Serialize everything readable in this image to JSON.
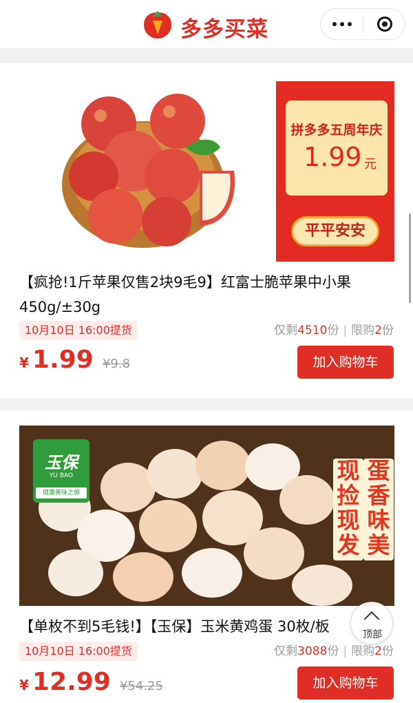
{
  "header": {
    "title": "多多买菜",
    "more_icon": "more-dots-icon",
    "close_icon": "close-target-icon"
  },
  "products": [
    {
      "promo": {
        "title": "拼多多五周年庆",
        "price": "1.99",
        "unit": "元",
        "badge": "平平安安"
      },
      "title": "【疯抢!1斤苹果仅售2块9毛9】红富士脆苹果中小果 450g/±30g",
      "pickup": "10月10日 16:00提货",
      "stock_prefix": "仅剩",
      "stock_count": "4510",
      "stock_suffix": "份",
      "limit_prefix": "限购",
      "limit_count": "2",
      "limit_suffix": "份",
      "currency": "¥",
      "price": "1.99",
      "original_price": "¥9.8",
      "cart_label": "加入购物车"
    },
    {
      "brand": {
        "name": "玉保",
        "pinyin": "YU BAO",
        "slogan": "健康美味之旅"
      },
      "slogan_left": "现捡现发",
      "slogan_right": "蛋香味美",
      "title": "【单枚不到5毛钱!】【玉保】玉米黄鸡蛋 30枚/板",
      "pickup": "10月10日 16:00提货",
      "stock_prefix": "仅剩",
      "stock_count": "3088",
      "stock_suffix": "份",
      "limit_prefix": "限购",
      "limit_count": "2",
      "limit_suffix": "份",
      "currency": "¥",
      "price": "12.99",
      "original_price": "¥54.25",
      "cart_label": "加入购物车"
    }
  ],
  "back_to_top": {
    "label": "顶部",
    "icon": "chevron-up-icon"
  },
  "colors": {
    "accent": "#e02e24",
    "muted": "#999999",
    "tag_bg": "#fdeceb"
  }
}
